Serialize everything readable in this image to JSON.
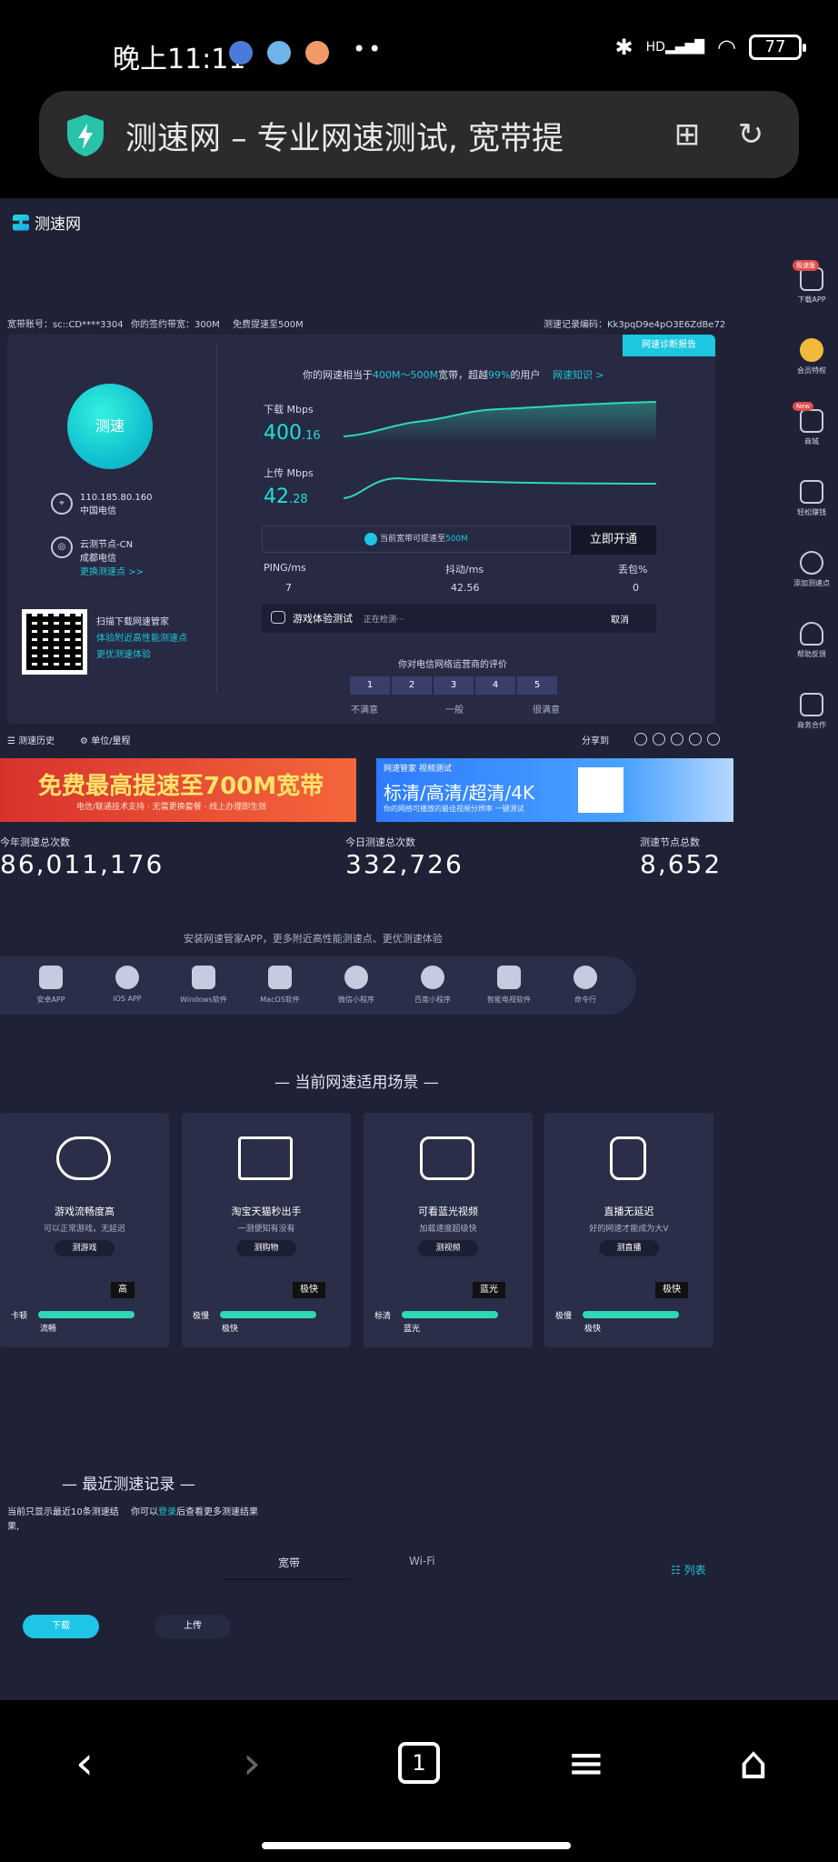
{
  "status_bar": {
    "time": "晚上11:11",
    "network_label": "HD",
    "battery": "77"
  },
  "browser": {
    "page_title": "测速网 – 专业网速测试, 宽带提"
  },
  "site": {
    "logo_text": "测速网",
    "account": "宽带账号：sc::CD****3304",
    "plan": "你的签约带宽：300M",
    "upgrade_link": "免费提速至500M",
    "record_code": "测速记录编码：Kk3pqD9e4pO3E6ZdBe72",
    "diag_button": "网速诊断报告",
    "gauge_label": "测速",
    "ip": "110.185.80.160",
    "isp": "中国电信",
    "node": "云测节点-CN",
    "node_isp": "成都电信",
    "change_node": "更换测速点 >>",
    "qr_line1": "扫描下载网速管家",
    "qr_line2": "体验附近高性能测速点",
    "qr_line3": "更优测速体验",
    "headline_pre": "你的网速相当于",
    "headline_range": "400M～500M",
    "headline_mid": "宽带，超越",
    "headline_pct": "99%",
    "headline_post": "的用户",
    "knowledge_link": "网速知识 >",
    "download_label": "下载 Mbps",
    "download_int": "400",
    "download_dec": ".16",
    "upload_label": "上传 Mbps",
    "upload_int": "42",
    "upload_dec": ".28",
    "upgrade_tip_pre": "当前宽带可提速至",
    "upgrade_tip_val": "500M",
    "open_button": "立即开通",
    "ping_label": "PING/ms",
    "ping_value": "7",
    "jitter_label": "抖动/ms",
    "jitter_value": "42.56",
    "loss_label": "丢包%",
    "loss_value": "0",
    "game_test": "游戏体验测试",
    "game_status": "正在检测···",
    "cancel": "取消",
    "rating_title": "你对电信网络运营商的评价",
    "rating_options": [
      "1",
      "2",
      "3",
      "4",
      "5"
    ],
    "rating_low": "不满意",
    "rating_mid": "一般",
    "rating_high": "很满意",
    "history": "测速历史",
    "units": "单位/量程",
    "share": "分享到"
  },
  "sidebar": [
    {
      "label": "下载APP",
      "badge": "极速版"
    },
    {
      "label": "会员特权",
      "badge": ""
    },
    {
      "label": "商城",
      "badge": "New"
    },
    {
      "label": "轻松赚钱",
      "badge": ""
    },
    {
      "label": "添加测速点",
      "badge": ""
    },
    {
      "label": "帮助反馈",
      "badge": ""
    },
    {
      "label": "商务合作",
      "badge": ""
    }
  ],
  "banners": {
    "left_big": "免费最高提速至700M宽带",
    "left_small": "电信/联通技术支持 · 无需更换套餐 · 线上办理即生效",
    "right_tag": "网速管家 视频测试",
    "right_big": "标清/高清/超清/4K",
    "right_small": "你的网络可播放的最佳视频分辨率 一键测试"
  },
  "counts": {
    "year_label": "今年测速总次数",
    "year_value": "86,011,176",
    "today_label": "今日测速总次数",
    "today_value": "332,726",
    "nodes_label": "测速节点总数",
    "nodes_value": "8,652"
  },
  "apps": {
    "tip": "安装网速管家APP，更多附近高性能测速点、更优测速体验",
    "items": [
      "安卓APP",
      "iOS APP",
      "Windows软件",
      "MacOS软件",
      "微信小程序",
      "百度小程序",
      "智能电视软件",
      "命令行"
    ]
  },
  "scenes": {
    "title": "— 当前网速适用场景 —",
    "items": [
      {
        "title": "游戏流畅度高",
        "desc": "可以正常游戏，无延迟",
        "button": "测游戏",
        "tip": "高",
        "left": "卡顿",
        "low": "流畅"
      },
      {
        "title": "淘宝天猫秒出手",
        "desc": "一测便知有没有",
        "button": "测购物",
        "tip": "极快",
        "left": "极慢",
        "low": "极快"
      },
      {
        "title": "可看蓝光视频",
        "desc": "加载速度超级快",
        "button": "测视频",
        "tip": "蓝光",
        "left": "标清",
        "low": "蓝光"
      },
      {
        "title": "直播无延迟",
        "desc": "好的网速才能成为大V",
        "button": "测直播",
        "tip": "极快",
        "left": "极慢",
        "low": "极快"
      }
    ]
  },
  "records": {
    "title": "— 最近测速记录 —",
    "note1": "当前只显示最近10条测速结果,",
    "note2_pre": "你可以",
    "note2_link": "登录",
    "note2_post": "后查看更多测速结果",
    "tab_broadband": "宽带",
    "tab_wifi": "Wi-Fi",
    "list": "列表",
    "download": "下载",
    "upload": "上传"
  },
  "nav": {
    "tab_count": "1"
  }
}
